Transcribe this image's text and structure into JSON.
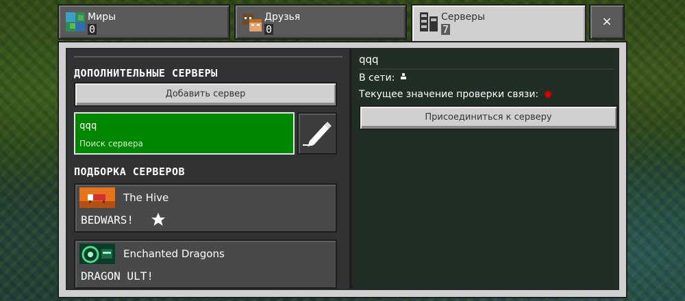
{
  "tabs": [
    {
      "label": "Миры",
      "count": "0",
      "icon": "world-icon"
    },
    {
      "label": "Друзья",
      "count": "0",
      "icon": "friends-icon"
    },
    {
      "label": "Серверы",
      "count": "7",
      "icon": "servers-icon"
    }
  ],
  "close_label": "×",
  "left": {
    "additional_title": "ДОПОЛНИТЕЛЬНЫЕ СЕРВЕРЫ",
    "add_server_label": "Добавить сервер",
    "selected_server": {
      "name": "qqq",
      "status": "Поиск сервера"
    },
    "featured_title": "ПОДБОРКА СЕРВЕРОВ",
    "featured": [
      {
        "name": "The Hive",
        "tag": "BEDWARS!"
      },
      {
        "name": "Enchanted Dragons",
        "tag": "DRAGON ULT!"
      }
    ]
  },
  "right": {
    "server_name": "qqq",
    "online_label": "В сети:",
    "ping_label": "Текущее значение проверки связи:",
    "join_label": "Присоединиться к серверу"
  },
  "colors": {
    "selected_row": "#008700",
    "ping_dot": "#d00000",
    "panel": "#d0d0d0"
  }
}
